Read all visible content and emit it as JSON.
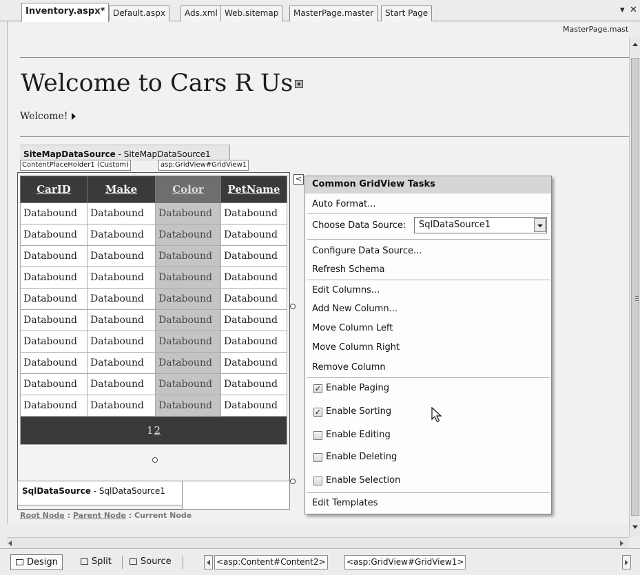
{
  "tabs": [
    {
      "label": "Inventory.aspx*",
      "active": true
    },
    {
      "label": "Default.aspx",
      "active": false
    },
    {
      "label": "Ads.xml",
      "active": false
    },
    {
      "label": "Web.sitemap",
      "active": false
    },
    {
      "label": "MasterPage.master",
      "active": false
    },
    {
      "label": "Start Page",
      "active": false
    }
  ],
  "tabstrip": {
    "dropdown_glyph": "▾",
    "close_glyph": "✕"
  },
  "editor": {
    "master_label": "MasterPage.maste",
    "page_title": "Welcome to Cars R Us",
    "menu_text": "Welcome!",
    "sitemap_control": {
      "type": "SiteMapDataSource",
      "sep": " - ",
      "id": "SiteMapDataSource1"
    },
    "content_tag": "ContentPlaceHolder1 (Custom)",
    "gridview_tag": "asp:GridView#GridView1",
    "smart_tag_glyph": "<",
    "gridview": {
      "columns": [
        "CarID",
        "Make",
        "Color",
        "PetName"
      ],
      "selected_column": "Color",
      "rows": [
        [
          "Databound",
          "Databound",
          "Databound",
          "Databound"
        ],
        [
          "Databound",
          "Databound",
          "Databound",
          "Databound"
        ],
        [
          "Databound",
          "Databound",
          "Databound",
          "Databound"
        ],
        [
          "Databound",
          "Databound",
          "Databound",
          "Databound"
        ],
        [
          "Databound",
          "Databound",
          "Databound",
          "Databound"
        ],
        [
          "Databound",
          "Databound",
          "Databound",
          "Databound"
        ],
        [
          "Databound",
          "Databound",
          "Databound",
          "Databound"
        ],
        [
          "Databound",
          "Databound",
          "Databound",
          "Databound"
        ],
        [
          "Databound",
          "Databound",
          "Databound",
          "Databound"
        ],
        [
          "Databound",
          "Databound",
          "Databound",
          "Databound"
        ]
      ],
      "pager": {
        "current": "1",
        "link": "2"
      }
    },
    "sql_datasource": {
      "type": "SqlDataSource",
      "sep": " - ",
      "id": "SqlDataSource1"
    },
    "breadcrumb": {
      "root": "Root Node",
      "sep": " : ",
      "parent": "Parent Node",
      "current": "Current Node"
    }
  },
  "tasks_panel": {
    "title": "Common GridView Tasks",
    "auto_format": "Auto Format...",
    "choose_ds_label": "Choose Data Source:",
    "choose_ds_value": "SqlDataSource1",
    "configure_ds": "Configure Data Source...",
    "refresh_schema": "Refresh Schema",
    "edit_columns": "Edit Columns...",
    "add_column": "Add New Column...",
    "move_left": "Move Column Left",
    "move_right": "Move Column Right",
    "remove_column": "Remove Column",
    "options": [
      {
        "label": "Enable Paging",
        "checked": true
      },
      {
        "label": "Enable Sorting",
        "checked": true
      },
      {
        "label": "Enable Editing",
        "checked": false
      },
      {
        "label": "Enable Deleting",
        "checked": false
      },
      {
        "label": "Enable Selection",
        "checked": false
      }
    ],
    "edit_templates": "Edit Templates"
  },
  "bottom_bar": {
    "views": [
      {
        "label": "Design",
        "icon": "design-view-icon",
        "active": true
      },
      {
        "label": "Split",
        "icon": "split-view-icon",
        "active": false
      },
      {
        "label": "Source",
        "icon": "source-view-icon",
        "active": false
      }
    ],
    "tag_path": [
      "<asp:Content#Content2>",
      "<asp:GridView#GridView1>"
    ]
  }
}
